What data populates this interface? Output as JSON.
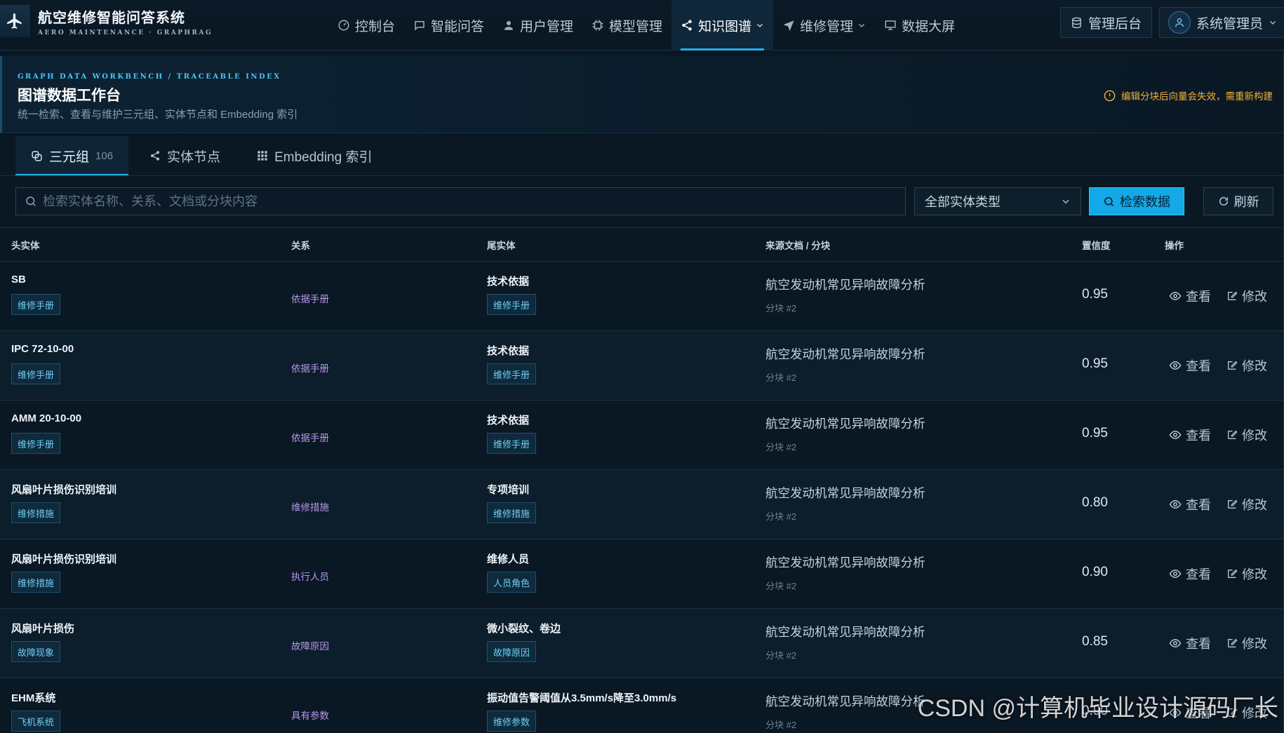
{
  "nav": {
    "brand_title": "航空维修智能问答系统",
    "brand_subtitle": "AERO MAINTENANCE · GRAPHRAG",
    "items": [
      {
        "label": "控制台",
        "icon": "dashboard-icon"
      },
      {
        "label": "智能问答",
        "icon": "chat-icon"
      },
      {
        "label": "用户管理",
        "icon": "user-icon"
      },
      {
        "label": "模型管理",
        "icon": "chip-icon"
      },
      {
        "label": "知识图谱",
        "icon": "share-icon",
        "active": true,
        "dropdown": true
      },
      {
        "label": "维修管理",
        "icon": "send-icon",
        "dropdown": true
      },
      {
        "label": "数据大屏",
        "icon": "screen-icon"
      }
    ],
    "admin_label": "管理后台",
    "user_label": "系统管理员"
  },
  "header": {
    "eyebrow": "GRAPH DATA WORKBENCH / TRACEABLE INDEX",
    "title": "图谱数据工作台",
    "description": "统一检索、查看与维护三元组、实体节点和 Embedding 索引",
    "warning": "编辑分块后向量会失效，需重新构建"
  },
  "tabs": [
    {
      "label": "三元组",
      "count": "106",
      "active": true
    },
    {
      "label": "实体节点"
    },
    {
      "label": "Embedding 索引"
    }
  ],
  "filters": {
    "search_placeholder": "检索实体名称、关系、文档或分块内容",
    "entity_type": "全部实体类型",
    "search_button": "检索数据",
    "refresh_button": "刷新"
  },
  "table": {
    "columns": [
      "头实体",
      "关系",
      "尾实体",
      "来源文档 / 分块",
      "置信度",
      "操作"
    ],
    "view_label": "查看",
    "edit_label": "修改",
    "rows": [
      {
        "head": "SB",
        "head_tag": "维修手册",
        "relation": "依据手册",
        "tail": "技术依据",
        "tail_tag": "维修手册",
        "source": "航空发动机常见异响故障分析",
        "chunk": "分块 #2",
        "confidence": "0.95"
      },
      {
        "head": "IPC 72-10-00",
        "head_tag": "维修手册",
        "relation": "依据手册",
        "tail": "技术依据",
        "tail_tag": "维修手册",
        "source": "航空发动机常见异响故障分析",
        "chunk": "分块 #2",
        "confidence": "0.95"
      },
      {
        "head": "AMM 20-10-00",
        "head_tag": "维修手册",
        "relation": "依据手册",
        "tail": "技术依据",
        "tail_tag": "维修手册",
        "source": "航空发动机常见异响故障分析",
        "chunk": "分块 #2",
        "confidence": "0.95"
      },
      {
        "head": "风扇叶片损伤识别培训",
        "head_tag": "维修措施",
        "relation": "维修措施",
        "tail": "专项培训",
        "tail_tag": "维修措施",
        "source": "航空发动机常见异响故障分析",
        "chunk": "分块 #2",
        "confidence": "0.80"
      },
      {
        "head": "风扇叶片损伤识别培训",
        "head_tag": "维修措施",
        "relation": "执行人员",
        "tail": "维修人员",
        "tail_tag": "人员角色",
        "source": "航空发动机常见异响故障分析",
        "chunk": "分块 #2",
        "confidence": "0.90"
      },
      {
        "head": "风扇叶片损伤",
        "head_tag": "故障现象",
        "relation": "故障原因",
        "tail": "微小裂纹、卷边",
        "tail_tag": "故障原因",
        "source": "航空发动机常见异响故障分析",
        "chunk": "分块 #2",
        "confidence": "0.85"
      },
      {
        "head": "EHM系统",
        "head_tag": "飞机系统",
        "relation": "具有参数",
        "tail": "振动值告警阈值从3.5mm/s降至3.0mm/s",
        "tail_tag": "维修参数",
        "source": "航空发动机常见异响故障分析",
        "chunk": "分块 #2",
        "confidence": "0.90"
      }
    ]
  },
  "watermark": "CSDN @计算机毕业设计源码厂长",
  "colors": {
    "accent": "#13a9e9",
    "warning": "#f3b33a",
    "relation": "#b897e8",
    "tag": "#6fd0f4"
  }
}
